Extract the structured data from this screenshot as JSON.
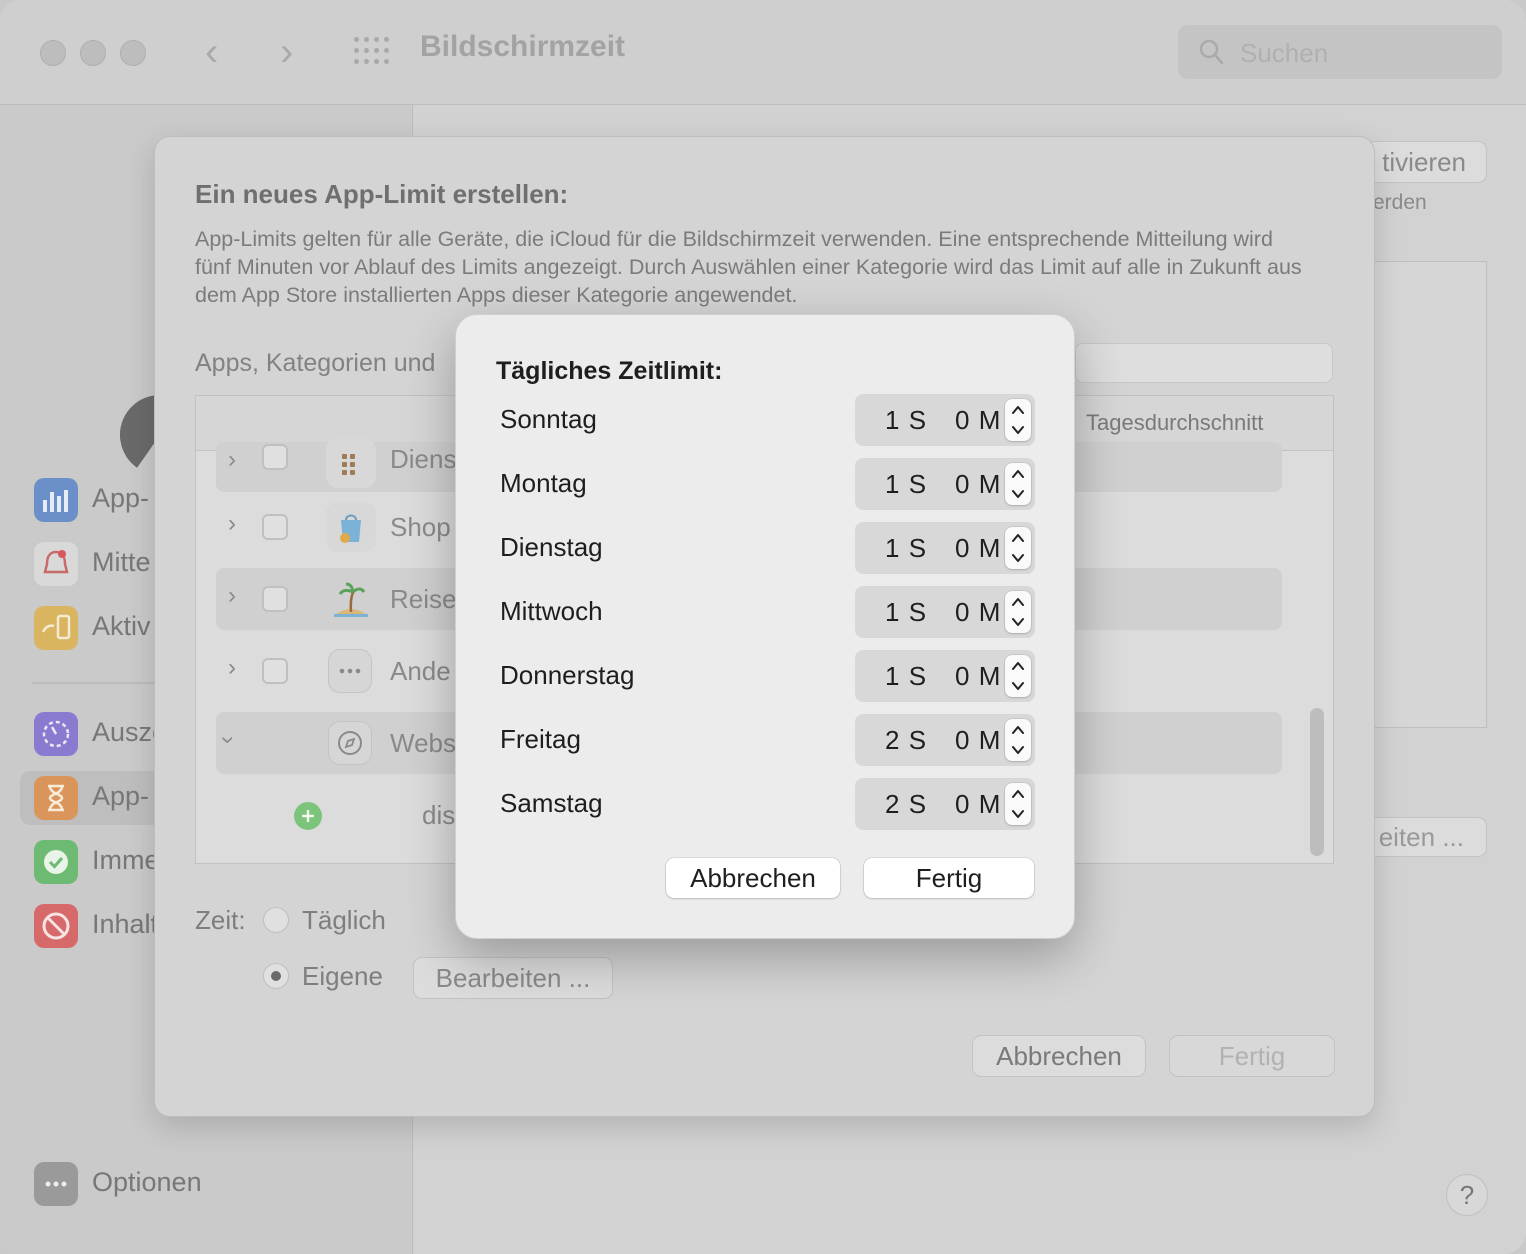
{
  "window": {
    "title": "Bildschirmzeit",
    "search_placeholder": "Suchen"
  },
  "sidebar": {
    "items": [
      {
        "label": "App-",
        "icon": "bar-chart-icon",
        "color": "#3d7be0"
      },
      {
        "label": "Mitte",
        "icon": "bell-icon",
        "color": "#e34040"
      },
      {
        "label": "Aktiv",
        "icon": "device-pickup-icon",
        "color": "#e8b22a"
      },
      {
        "label": "Ausze",
        "icon": "downtime-icon",
        "color": "#7a5ce0"
      },
      {
        "label": "App-",
        "icon": "hourglass-icon",
        "color": "#ef8a2d"
      },
      {
        "label": "Imme",
        "icon": "check-badge-icon",
        "color": "#3cb548"
      },
      {
        "label": "Inhalt",
        "icon": "restriction-icon",
        "color": "#e03a3a"
      }
    ],
    "options_label": "Optionen"
  },
  "background": {
    "activate_label": "tivieren",
    "werden_text": "erden",
    "edit_label": "eiten ..."
  },
  "sheet": {
    "title": "Ein neues App-Limit erstellen:",
    "description": "App-Limits gelten für alle Geräte, die iCloud für die Bildschirmzeit verwenden. Eine entsprechende Mitteilung wird fünf Minuten vor Ablauf des Limits angezeigt. Durch Auswählen einer Kategorie wird das Limit auf alle in Zukunft aus dem App Store installierten Apps dieser Kategorie angewendet.",
    "search_label": "Apps, Kategorien und",
    "column_header": "Tagesdurchschnitt",
    "rows": [
      {
        "label": "Diens",
        "icon": "utilities-icon"
      },
      {
        "label": "Shop",
        "icon": "shopping-bag-icon"
      },
      {
        "label": "Reise",
        "icon": "island-icon"
      },
      {
        "label": "Ande",
        "icon": "more-icon"
      },
      {
        "label": "Webs",
        "icon": "compass-icon"
      },
      {
        "label": "dis",
        "icon": "add-icon"
      }
    ],
    "zeit_label": "Zeit:",
    "option_daily": "Täglich",
    "option_custom": "Eigene",
    "edit_button": "Bearbeiten ...",
    "cancel_button": "Abbrechen",
    "done_button": "Fertig"
  },
  "modal": {
    "title": "Tägliches Zeitlimit:",
    "days": [
      {
        "day": "Sonntag",
        "hours": "1",
        "minutes": "0"
      },
      {
        "day": "Montag",
        "hours": "1",
        "minutes": "0"
      },
      {
        "day": "Dienstag",
        "hours": "1",
        "minutes": "0"
      },
      {
        "day": "Mittwoch",
        "hours": "1",
        "minutes": "0"
      },
      {
        "day": "Donnerstag",
        "hours": "1",
        "minutes": "0"
      },
      {
        "day": "Freitag",
        "hours": "2",
        "minutes": "0"
      },
      {
        "day": "Samstag",
        "hours": "2",
        "minutes": "0"
      }
    ],
    "hour_unit": "S",
    "minute_unit": "M",
    "cancel_button": "Abbrechen",
    "done_button": "Fertig"
  },
  "help_label": "?"
}
